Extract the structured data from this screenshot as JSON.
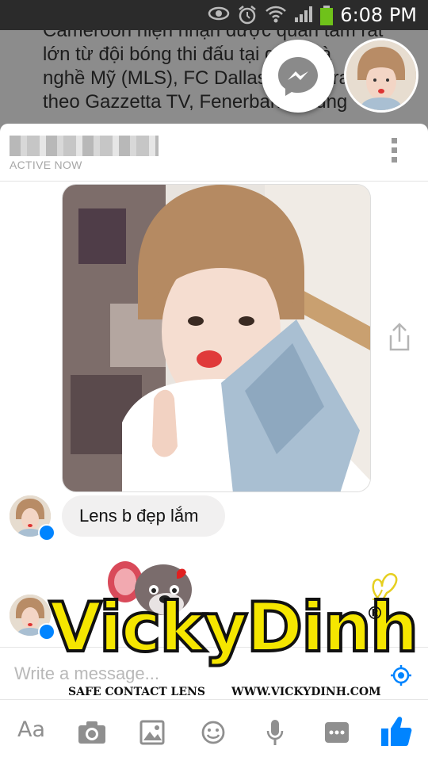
{
  "status_bar": {
    "time": "6:08 PM"
  },
  "background_article": {
    "lines": [
      "Cameroon hiện nhận được quan tâm rất",
      "lớn từ đội bóng thi đấu tại giải nhà",
      "nghề Mỹ (MLS), FC Dallas. Ngoài ra",
      "theo Gazzetta TV, Fenerbahce cũng"
    ]
  },
  "chat_header": {
    "status": "ACTIVE NOW"
  },
  "messages": {
    "text_message": "Lens b đẹp lắm"
  },
  "composer": {
    "placeholder": "Write a message..."
  },
  "toolbar": {
    "text_label": "Aa"
  },
  "watermark": {
    "brand": "VickyDinh",
    "registered": "®",
    "tagline": "SAFE CONTACT LENS",
    "website": "WWW.VICKYDINH.COM"
  },
  "colors": {
    "messenger_blue": "#0084ff",
    "bubble_gray": "#f1f0f0",
    "watermark_yellow": "#f5e600"
  }
}
